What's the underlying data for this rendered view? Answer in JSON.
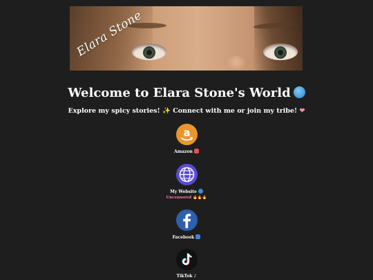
{
  "banner": {
    "signature": "Elara Stone"
  },
  "header": {
    "title": "Welcome to Elara Stone's World",
    "subtitle_main": "Explore my spicy stories!",
    "subtitle_rest": "Connect with me or join my tribe!"
  },
  "links": [
    {
      "label": "Amazon",
      "icon": "amazon-icon"
    },
    {
      "label": "My Website",
      "icon": "globe-icon",
      "note": "Uncensored 🔥🔥🔥"
    },
    {
      "label": "Facebook",
      "icon": "facebook-icon"
    },
    {
      "label": "TikTok",
      "icon": "tiktok-icon"
    }
  ],
  "colors": {
    "background": "#1e1e1e",
    "amazon": "#e8962e",
    "website": "#5b4bd6",
    "facebook": "#2d5fae",
    "tiktok": "#111111",
    "note": "#ff7ab5"
  }
}
